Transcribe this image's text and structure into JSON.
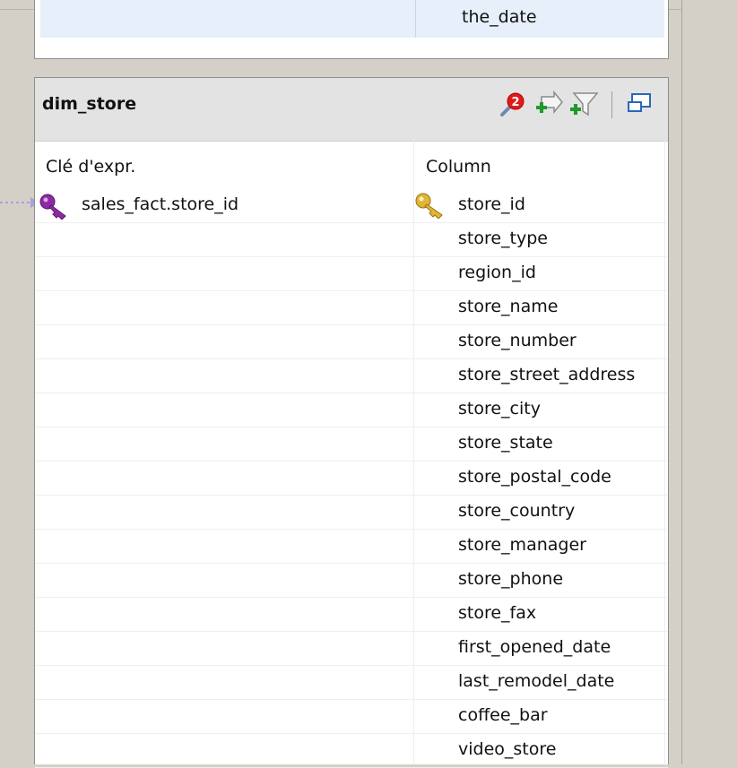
{
  "previous_table": {
    "visible_row_column": "the_date"
  },
  "dim_store": {
    "title": "dim_store",
    "toolbar": {
      "error_badge_count": "2",
      "icons": [
        "error-badge-icon",
        "add-mapping-icon",
        "add-filter-icon",
        "edit-window-icon"
      ]
    },
    "headers": {
      "key_expr": "Clé d'expr.",
      "column": "Column"
    },
    "rows": [
      {
        "key_expr": "sales_fact.store_id",
        "column": "store_id",
        "primary_key": true
      },
      {
        "key_expr": "",
        "column": "store_type"
      },
      {
        "key_expr": "",
        "column": "region_id"
      },
      {
        "key_expr": "",
        "column": "store_name"
      },
      {
        "key_expr": "",
        "column": "store_number"
      },
      {
        "key_expr": "",
        "column": "store_street_address"
      },
      {
        "key_expr": "",
        "column": "store_city"
      },
      {
        "key_expr": "",
        "column": "store_state"
      },
      {
        "key_expr": "",
        "column": "store_postal_code"
      },
      {
        "key_expr": "",
        "column": "store_country"
      },
      {
        "key_expr": "",
        "column": "store_manager"
      },
      {
        "key_expr": "",
        "column": "store_phone"
      },
      {
        "key_expr": "",
        "column": "store_fax"
      },
      {
        "key_expr": "",
        "column": "first_opened_date"
      },
      {
        "key_expr": "",
        "column": "last_remodel_date"
      },
      {
        "key_expr": "",
        "column": "coffee_bar"
      },
      {
        "key_expr": "",
        "column": "video_store"
      }
    ]
  },
  "colors": {
    "background": "#d4d0c8",
    "header_bg": "#e3e3e3",
    "selected_row": "#e6effa",
    "key_purple": "#8e2aa3",
    "key_gold": "#e0b53a"
  }
}
